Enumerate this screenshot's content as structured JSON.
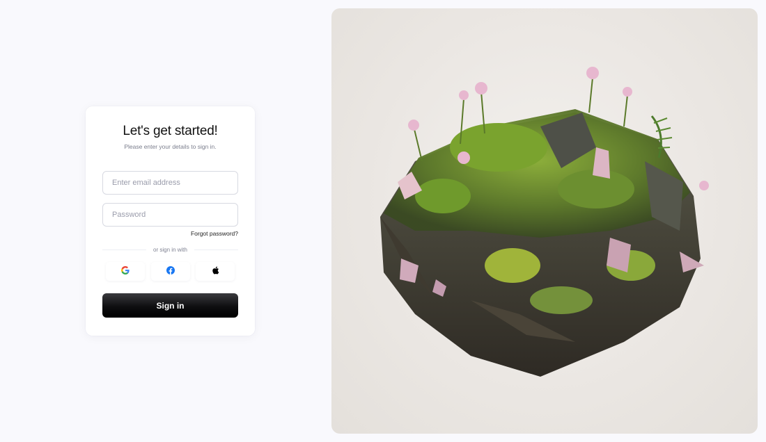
{
  "login": {
    "title": "Let's get started!",
    "subtitle": "Please enter your details to sign in.",
    "email_placeholder": "Enter email address",
    "password_placeholder": "Password",
    "forgot_password": "Forgot password?",
    "divider_text": "or sign in with",
    "social": [
      {
        "icon": "google-icon"
      },
      {
        "icon": "facebook-icon"
      },
      {
        "icon": "apple-icon"
      }
    ],
    "signin_label": "Sign in"
  },
  "colors": {
    "page_bg": "#f9f9fd",
    "card_bg": "#ffffff",
    "button_bg": "#0e0e10",
    "google_blue": "#4285F4",
    "google_red": "#EA4335",
    "google_yellow": "#FBBC05",
    "google_green": "#34A853",
    "facebook_blue": "#1877F2"
  },
  "hero": {
    "image": "floating-moss-rock-island-with-crystals-and-flowers"
  }
}
